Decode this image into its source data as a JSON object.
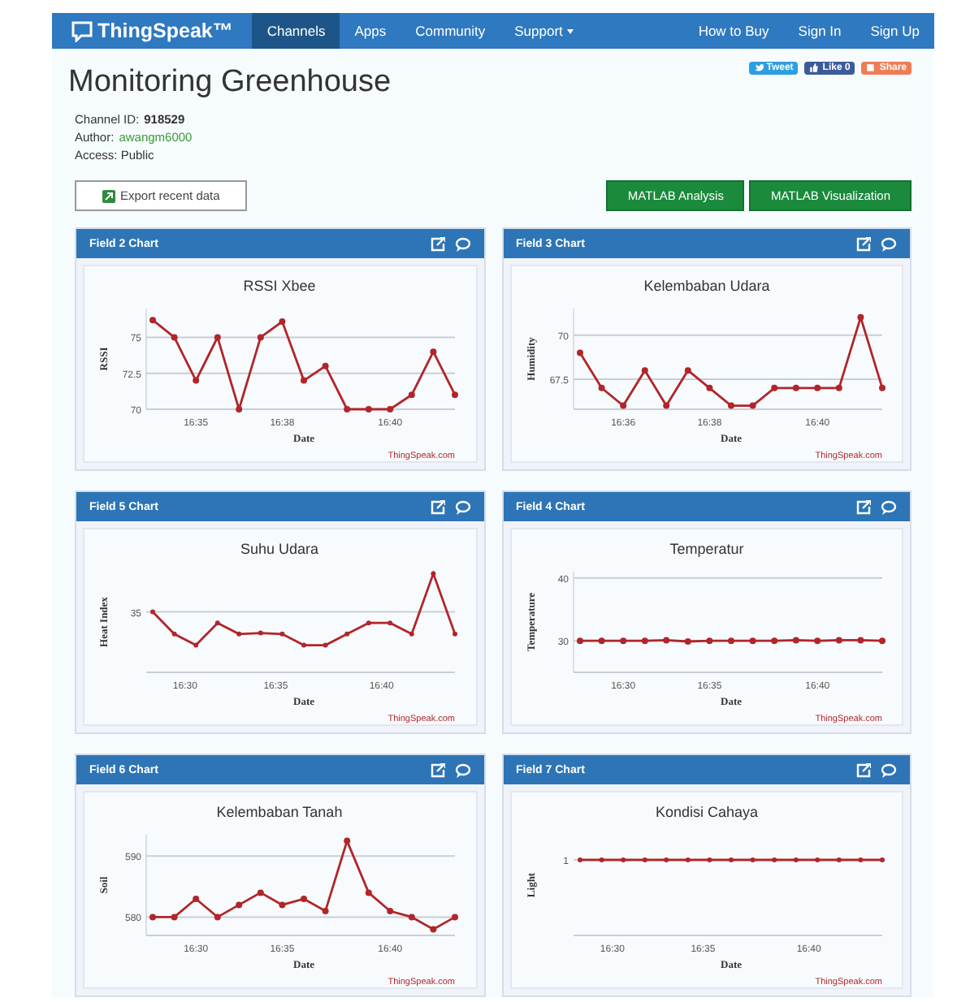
{
  "nav": {
    "brand": "ThingSpeak™",
    "items": [
      {
        "label": "Channels",
        "selected": true,
        "dropdown": false
      },
      {
        "label": "Apps",
        "selected": false,
        "dropdown": false
      },
      {
        "label": "Community",
        "selected": false,
        "dropdown": false
      },
      {
        "label": "Support",
        "selected": false,
        "dropdown": true
      }
    ],
    "right_items": [
      "How to Buy",
      "Sign In",
      "Sign Up"
    ]
  },
  "share_buttons": [
    {
      "kind": "tweet",
      "label": "Tweet"
    },
    {
      "kind": "like",
      "label": "Like 0"
    },
    {
      "kind": "share",
      "label": "Share"
    }
  ],
  "channel": {
    "title": "Monitoring Greenhouse",
    "id_label": "Channel ID:",
    "id": "918529",
    "author_label": "Author:",
    "author": "awangm6000",
    "access": "Access: Public"
  },
  "export_button": "Export recent data",
  "matlab_buttons": [
    "MATLAB Analysis",
    "MATLAB Visualization"
  ],
  "panels": [
    {
      "header": "Field 2 Chart",
      "chart": {
        "kind": "data",
        "credit": "ThingSpeak.com",
        "chart_data": {
          "type": "line",
          "title": "RSSI Xbee",
          "xlabel": "Date",
          "ylabel": "RSSI",
          "ylim": [
            70,
            77
          ],
          "categories": [
            null,
            null,
            "16:35",
            null,
            null,
            null,
            "16:38",
            null,
            null,
            null,
            null,
            "16:40",
            null,
            null,
            null
          ],
          "series": [
            {
              "color": "#b0262a",
              "marker": "circle",
              "values": [
                76.2,
                75,
                72,
                75,
                70,
                75,
                76.1,
                72,
                73,
                70,
                70,
                70,
                71,
                74,
                71
              ]
            }
          ],
          "yticks": [
            70,
            72.5,
            75
          ]
        }
      }
    },
    {
      "header": "Field 3 Chart",
      "chart": {
        "kind": "data",
        "credit": "ThingSpeak.com",
        "chart_data": {
          "type": "line",
          "title": "Kelembaban Udara",
          "xlabel": "Date",
          "ylabel": "Humidity",
          "ylim": [
            65.8,
            71.5
          ],
          "categories": [
            null,
            null,
            "16:36",
            null,
            null,
            null,
            "16:38",
            null,
            null,
            null,
            null,
            "16:40",
            null,
            null,
            null
          ],
          "series": [
            {
              "color": "#b0262a",
              "marker": "circle",
              "values": [
                69,
                67,
                66,
                68,
                66,
                68,
                67,
                66,
                66,
                67,
                67,
                67,
                67,
                71,
                67
              ]
            }
          ],
          "yticks": [
            67.5,
            70
          ]
        }
      }
    },
    {
      "header": "Field 5 Chart",
      "chart": {
        "kind": "picture",
        "title": "Suhu Udara",
        "xlabel": "Date",
        "ylabel": "Heat Index",
        "y_tick_labels": [
          "35"
        ],
        "x_tick_labels": [
          "16:30",
          "16:35",
          "16:40"
        ],
        "credit": "ThingSpeak.com"
      }
    },
    {
      "header": "Field 4 Chart",
      "chart": {
        "kind": "data",
        "credit": "ThingSpeak.com",
        "chart_data": {
          "type": "line",
          "title": "Temperatur",
          "xlabel": "Date",
          "ylabel": "Temperature",
          "ylim": [
            25,
            41
          ],
          "categories": [
            null,
            null,
            "16:30",
            null,
            null,
            null,
            "16:35",
            null,
            null,
            null,
            null,
            "16:40",
            null,
            null,
            null
          ],
          "series": [
            {
              "color": "#b0262a",
              "marker": "circle",
              "values": [
                30,
                30,
                30,
                30,
                30.1,
                29.9,
                30,
                30,
                30,
                30,
                30.1,
                30,
                30.1,
                30.1,
                30
              ]
            }
          ],
          "yticks": [
            30,
            40
          ]
        }
      }
    },
    {
      "header": "Field 6 Chart",
      "chart": {
        "kind": "data",
        "credit": "ThingSpeak.com",
        "chart_data": {
          "type": "line",
          "title": "Kelembaban Tanah",
          "xlabel": "Date",
          "ylabel": "Soil",
          "ylim": [
            577,
            593.5
          ],
          "categories": [
            null,
            null,
            "16:30",
            null,
            null,
            null,
            "16:35",
            null,
            null,
            null,
            null,
            "16:40",
            null,
            null,
            null
          ],
          "series": [
            {
              "color": "#b0262a",
              "marker": "circle",
              "values": [
                580,
                580,
                583,
                580,
                582,
                584,
                582,
                583,
                581,
                592.5,
                584,
                581,
                580,
                578,
                580
              ]
            }
          ],
          "yticks": [
            580,
            590
          ]
        }
      }
    },
    {
      "header": "Field 7 Chart",
      "chart": {
        "kind": "picture",
        "title": "Kondisi Cahaya",
        "xlabel": "Date",
        "ylabel": "Light",
        "y_tick_labels": [
          "1"
        ],
        "x_tick_labels": [
          "16:30",
          "16:35",
          "16:40"
        ],
        "credit": "ThingSpeak.com"
      }
    }
  ]
}
